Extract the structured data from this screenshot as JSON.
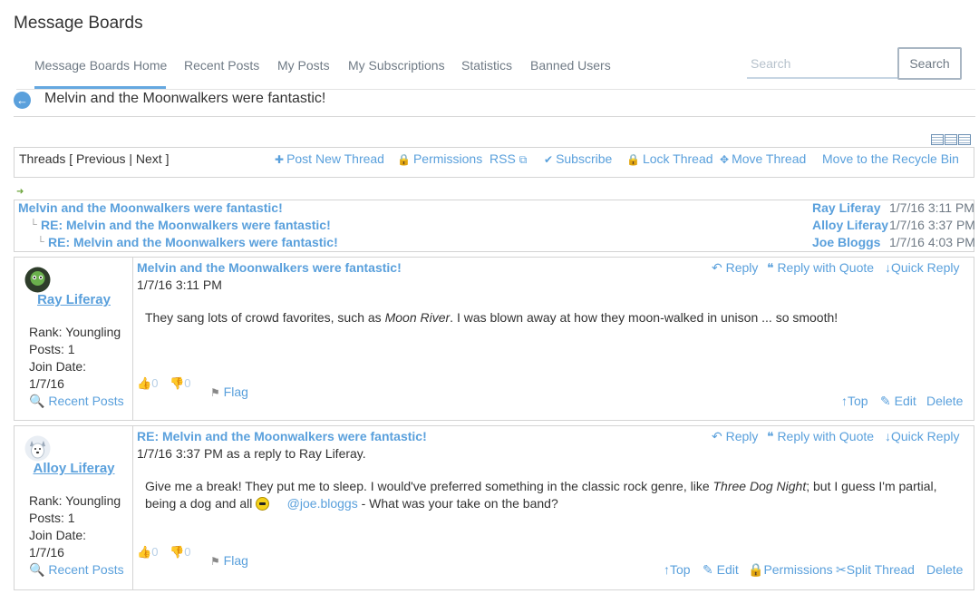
{
  "app": {
    "title": "Message Boards"
  },
  "nav": {
    "items": [
      "Message Boards Home",
      "Recent Posts",
      "My Posts",
      "My Subscriptions",
      "Statistics",
      "Banned Users"
    ],
    "active": "Message Boards Home"
  },
  "search": {
    "placeholder": "Search",
    "value": "",
    "button_label": "Search"
  },
  "thread": {
    "heading": "Melvin and the Moonwalkers were fantastic!"
  },
  "toolbar": {
    "threads_nav": "Threads [ Previous | Next ]",
    "post_new_thread": "Post New Thread",
    "permissions": "Permissions",
    "rss": "RSS",
    "subscribe": "Subscribe",
    "lock_thread": "Lock Thread",
    "move_thread": "Move Thread",
    "recycle_bin": "Move to the Recycle Bin"
  },
  "tree": [
    {
      "subject": "Melvin and the Moonwalkers were fantastic!",
      "author": "Ray Liferay",
      "date": "1/7/16 3:11 PM"
    },
    {
      "subject": "RE: Melvin and the Moonwalkers were fantastic!",
      "author": "Alloy Liferay",
      "date": "1/7/16 3:37 PM"
    },
    {
      "subject": "RE: Melvin and the Moonwalkers were fantastic!",
      "author": "Joe Bloggs",
      "date": "1/7/16 4:03 PM"
    }
  ],
  "messages": [
    {
      "author": "Ray Liferay",
      "rank": "Rank: Youngling",
      "posts": "Posts: 1",
      "join_label": "Join Date:",
      "join_date": "1/7/16",
      "recent_posts": "Recent Posts",
      "subject": "Melvin and the Moonwalkers were fantastic!",
      "date": "1/7/16 3:11 PM",
      "body_1": "They sang lots of crowd favorites, such as ",
      "body_em": "Moon River",
      "body_2": ". I was blown away at how they moon-walked in unison ... so smooth!",
      "thumbs_up": "0",
      "thumbs_down": "0",
      "flag": "Flag",
      "reply": "Reply",
      "reply_quote": "Reply with Quote",
      "quick_reply": "Quick Reply",
      "top": "Top",
      "edit": "Edit",
      "delete": "Delete"
    },
    {
      "author": "Alloy Liferay",
      "rank": "Rank: Youngling",
      "posts": "Posts: 1",
      "join_label": "Join Date:",
      "join_date": "1/7/16",
      "recent_posts": "Recent Posts",
      "subject": "RE: Melvin and the Moonwalkers were fantastic!",
      "date": "1/7/16 3:37 PM as a reply to Ray Liferay.",
      "body_1": "Give me a break! They put me to sleep. I would've preferred something in the classic rock genre, like ",
      "body_em": "Three Dog Night",
      "body_2": "; but I guess I'm partial, being a dog and all",
      "mention": "@joe.bloggs",
      "body_3": " - What was your take on the band?",
      "thumbs_up": "0",
      "thumbs_down": "0",
      "flag": "Flag",
      "reply": "Reply",
      "reply_quote": "Reply with Quote",
      "quick_reply": "Quick Reply",
      "top": "Top",
      "edit": "Edit",
      "permissions": "Permissions",
      "split_thread": "Split Thread",
      "delete": "Delete"
    }
  ],
  "colors": {
    "link": "#5aa0dc",
    "nav_underline": "#65a8e0",
    "border": "#d4d4d4"
  },
  "icons": {
    "back": "arrow-left-circle-icon",
    "plus": "plus-icon",
    "lock": "lock-icon",
    "external": "external-link-icon",
    "check": "check-circle-icon",
    "move": "move-arrows-icon",
    "reply": "reply-arrow-icon",
    "quote": "quote-icon",
    "down": "arrow-down-icon",
    "search": "search-icon",
    "thumb_up": "thumbs-up-icon",
    "thumb_down": "thumbs-down-icon",
    "flag": "flag-icon",
    "up": "arrow-up-icon",
    "edit": "edit-icon",
    "split": "split-icon"
  }
}
